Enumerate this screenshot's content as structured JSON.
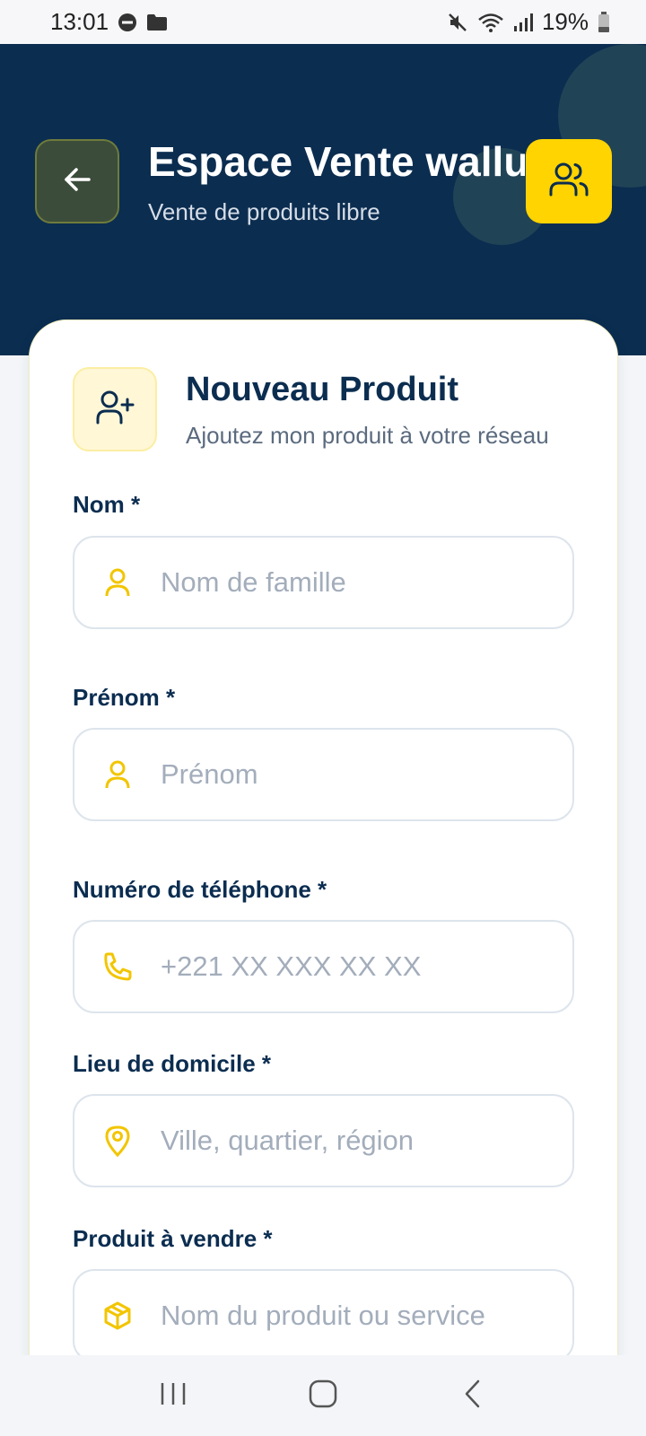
{
  "status_bar": {
    "time": "13:01",
    "battery": "19%",
    "icons": [
      "dnd-icon",
      "folder-icon",
      "mute-icon",
      "wifi-icon",
      "signal-icon",
      "battery-icon"
    ]
  },
  "header": {
    "title": "Espace Vente wallu",
    "subtitle": "Vente de produits libre",
    "back_icon": "arrow-left-icon",
    "group_icon": "users-icon"
  },
  "card": {
    "icon": "user-plus-icon",
    "title": "Nouveau Produit",
    "subtitle": "Ajoutez mon produit à votre réseau"
  },
  "form": {
    "nom": {
      "label": "Nom *",
      "placeholder": "Nom de famille",
      "value": "",
      "icon": "user-icon"
    },
    "prenom": {
      "label": "Prénom *",
      "placeholder": "Prénom",
      "value": "",
      "icon": "user-icon"
    },
    "telephone": {
      "label": "Numéro de téléphone *",
      "placeholder": "+221 XX XXX XX XX",
      "value": "",
      "icon": "phone-icon"
    },
    "domicile": {
      "label": "Lieu de domicile *",
      "placeholder": "Ville, quartier, région",
      "value": "",
      "icon": "map-pin-icon"
    },
    "produit": {
      "label": "Produit à vendre *",
      "placeholder": "Nom du produit ou service",
      "value": "",
      "icon": "box-icon"
    }
  },
  "colors": {
    "header_bg": "#0b2d50",
    "accent_yellow": "#ffd400",
    "text_dark": "#0b2d50",
    "placeholder": "#a3adbb"
  },
  "nav": {
    "buttons": [
      "recents-icon",
      "home-icon",
      "back-icon"
    ]
  }
}
